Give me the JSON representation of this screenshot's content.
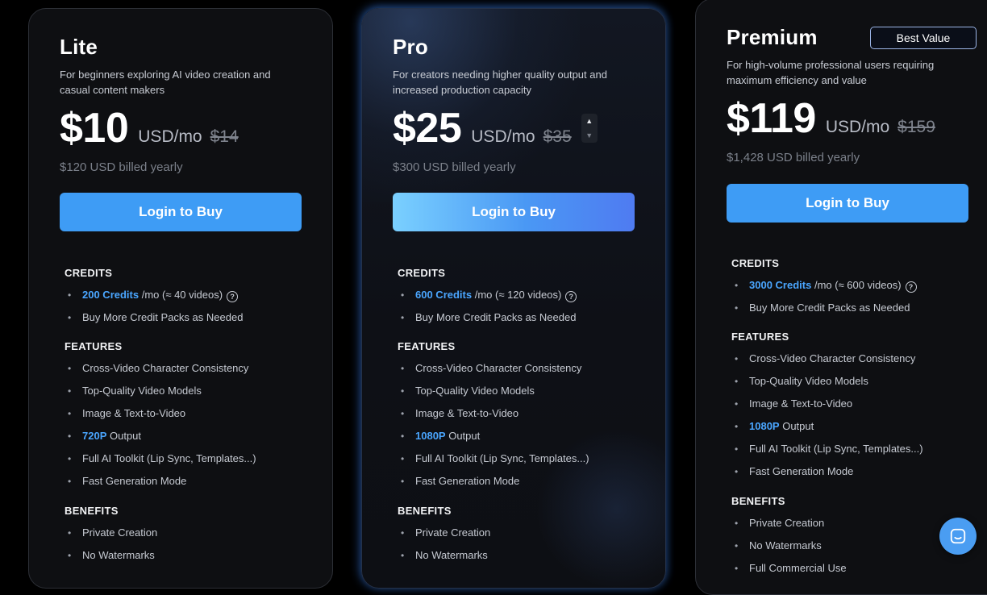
{
  "plans": {
    "lite": {
      "title": "Lite",
      "description": "For beginners exploring AI video creation and casual content makers",
      "price": "$10",
      "unit": "USD/mo",
      "old_price": "$14",
      "billed": "$120 USD billed yearly",
      "button": "Login to Buy",
      "credits_heading": "CREDITS",
      "credits_amount": "200 Credits",
      "credits_suffix": "/mo (≈ 40 videos)",
      "credits_extra": "Buy More Credit Packs as Needed",
      "features_heading": "FEATURES",
      "features": [
        "Cross-Video Character Consistency",
        "Top-Quality Video Models",
        "Image & Text-to-Video"
      ],
      "resolution": "720P",
      "resolution_suffix": "Output",
      "features_more": [
        "Full AI Toolkit (Lip Sync, Templates...)",
        "Fast Generation Mode"
      ],
      "benefits_heading": "BENEFITS",
      "benefits": [
        "Private Creation",
        "No Watermarks"
      ]
    },
    "pro": {
      "title": "Pro",
      "description": "For creators needing higher quality output and increased production capacity",
      "price": "$25",
      "unit": "USD/mo",
      "old_price": "$35",
      "billed": "$300 USD billed yearly",
      "button": "Login to Buy",
      "credits_heading": "CREDITS",
      "credits_amount": "600 Credits",
      "credits_suffix": "/mo (≈ 120 videos)",
      "credits_extra": "Buy More Credit Packs as Needed",
      "features_heading": "FEATURES",
      "features": [
        "Cross-Video Character Consistency",
        "Top-Quality Video Models",
        "Image & Text-to-Video"
      ],
      "resolution": "1080P",
      "resolution_suffix": "Output",
      "features_more": [
        "Full AI Toolkit (Lip Sync, Templates...)",
        "Fast Generation Mode"
      ],
      "benefits_heading": "BENEFITS",
      "benefits": [
        "Private Creation",
        "No Watermarks"
      ]
    },
    "premium": {
      "title": "Premium",
      "badge": "Best Value",
      "description": "For high-volume professional users requiring maximum efficiency and value",
      "price": "$119",
      "unit": "USD/mo",
      "old_price": "$159",
      "billed": "$1,428 USD billed yearly",
      "button": "Login to Buy",
      "credits_heading": "CREDITS",
      "credits_amount": "3000 Credits",
      "credits_suffix": "/mo (≈ 600 videos)",
      "credits_extra": "Buy More Credit Packs as Needed",
      "features_heading": "FEATURES",
      "features": [
        "Cross-Video Character Consistency",
        "Top-Quality Video Models",
        "Image & Text-to-Video"
      ],
      "resolution": "1080P",
      "resolution_suffix": "Output",
      "features_more": [
        "Full AI Toolkit (Lip Sync, Templates...)",
        "Fast Generation Mode"
      ],
      "benefits_heading": "BENEFITS",
      "benefits": [
        "Private Creation",
        "No Watermarks",
        "Full Commercial Use"
      ]
    }
  },
  "icons": {
    "help": "question-circle-icon",
    "stepper_up": "caret-up-icon",
    "stepper_down": "caret-down-icon",
    "chat": "chat-bubble-icon"
  },
  "colors": {
    "accent": "#3e9cf5",
    "highlight": "#4aa6ff",
    "background": "#000000"
  }
}
